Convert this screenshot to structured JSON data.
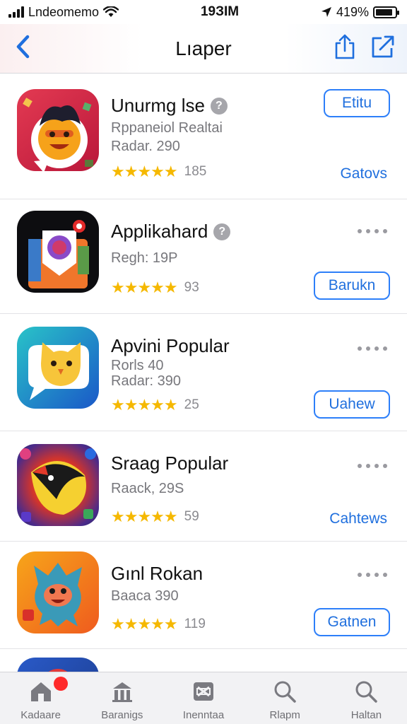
{
  "status_bar": {
    "carrier": "Lndeomemo",
    "time": "19ЗIM",
    "battery_text": "419%",
    "battery_level": 0.9
  },
  "nav": {
    "title": "Lıaper",
    "back_icon": "chevron-left-icon",
    "actions": [
      "share-icon",
      "compose-icon"
    ]
  },
  "apps": [
    {
      "name": "Unurmg lse",
      "lines": [
        "Rppaneiol Realtai",
        "Radar. 290"
      ],
      "stars": "★★★★★",
      "rating_count": "185",
      "button": "Etitu",
      "secondary_link": "Gatovs",
      "has_badge": true
    },
    {
      "name": "Applikahard",
      "lines": [
        "Regh: 19P"
      ],
      "stars": "★★★★★",
      "rating_count": "93",
      "button": "Barukn",
      "has_badge": true
    },
    {
      "name": "Apvini Popular",
      "lines": [
        "Rorls 40",
        "Radar: 390"
      ],
      "stars": "★★★★★",
      "rating_count": "25",
      "button": "Uahew"
    },
    {
      "name": "Sraag Popular",
      "lines": [
        "Raack, 29S"
      ],
      "stars": "★★★★★",
      "rating_count": "59",
      "text_button": "Cahtews"
    },
    {
      "name": "Gınl Rokan",
      "lines": [
        "Baaca 390"
      ],
      "stars": "★★★★★",
      "rating_count": "119",
      "button": "Gatnen"
    }
  ],
  "tabs": [
    {
      "label": "Kadaare",
      "icon": "home-icon",
      "active": true
    },
    {
      "label": "Baranigs",
      "icon": "library-icon"
    },
    {
      "label": "Inenntaa",
      "icon": "grid-box-icon"
    },
    {
      "label": "Rlapm",
      "icon": "search-icon"
    },
    {
      "label": "Haltan",
      "icon": "search-icon"
    }
  ],
  "colors": {
    "accent": "#1f6fde",
    "star": "#f5b800",
    "notification": "#ff2a2a"
  }
}
